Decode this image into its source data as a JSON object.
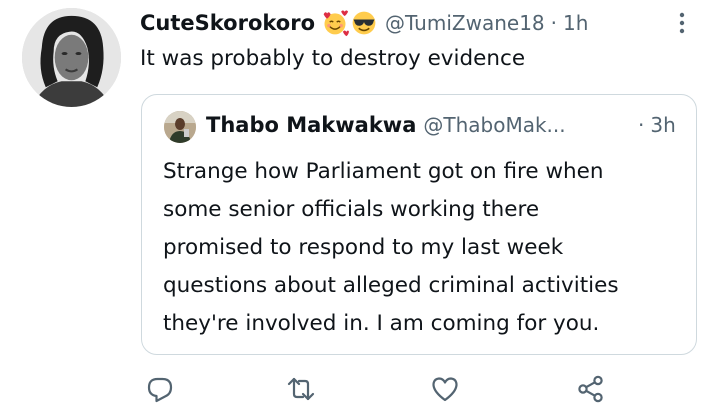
{
  "tweet": {
    "author_name": "CuteSkorokoro",
    "author_emojis": [
      "smiling-face-with-hearts-emoji",
      "smiling-face-with-sunglasses-emoji"
    ],
    "author_handle": "@TumiZwane18",
    "separator": "·",
    "time": "1h",
    "text": "It was probably to destroy evidence"
  },
  "quoted_tweet": {
    "author_name": "Thabo Makwakwa",
    "author_handle": "@ThaboMak...",
    "separator": "·",
    "time": "3h",
    "text_lines": [
      "Strange how Parliament got on fire when",
      "some senior officials working there",
      "promised to respond to my last week",
      "questions about alleged criminal activities",
      "they're involved in. I am coming for you."
    ]
  },
  "actions": [
    {
      "icon": "reply-icon"
    },
    {
      "icon": "retweet-icon"
    },
    {
      "icon": "like-icon"
    },
    {
      "icon": "share-icon"
    }
  ],
  "colors": {
    "text": "#0f1419",
    "secondary": "#536471",
    "border": "#cfd9de",
    "background": "#ffffff"
  }
}
